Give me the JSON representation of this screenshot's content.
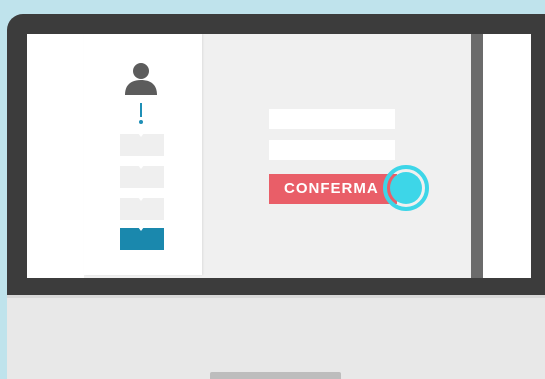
{
  "form": {
    "confirm_label": "CONFERMA"
  },
  "sidebar": {
    "icons": [
      "user-avatar-icon",
      "exclamation-icon"
    ],
    "items": [
      {
        "active": false
      },
      {
        "active": false
      },
      {
        "active": false
      },
      {
        "active": true
      }
    ]
  },
  "colors": {
    "background": "#bfe3ec",
    "monitor_frame": "#3c3c3c",
    "chin": "#e8e8e8",
    "accent_blue": "#1a88ad",
    "confirm_button": "#e95e68",
    "cursor_ring": "#3dd6e8"
  }
}
